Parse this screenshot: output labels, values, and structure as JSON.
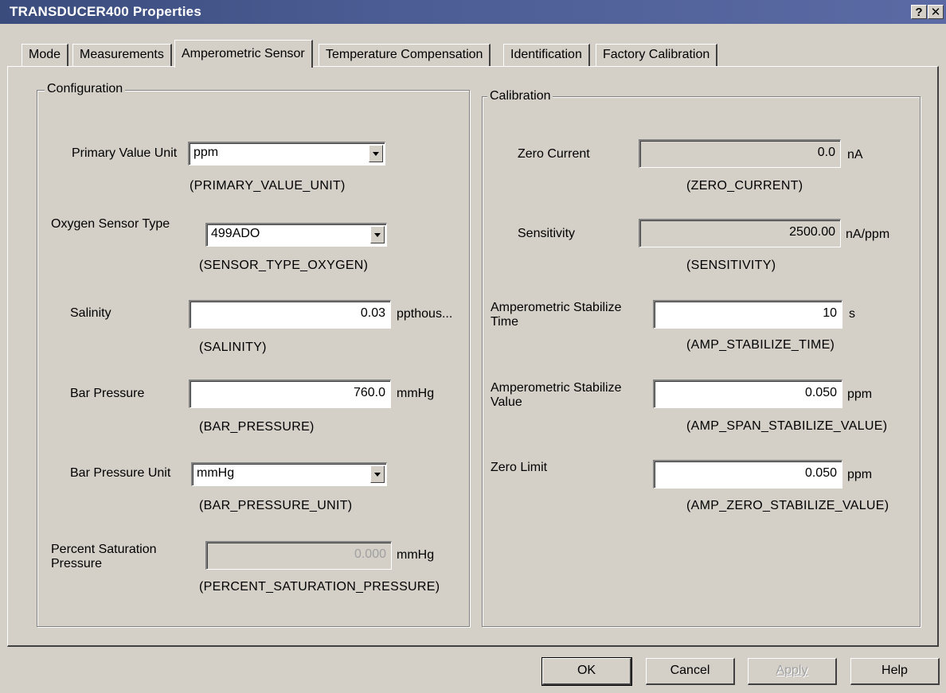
{
  "window": {
    "title": "TRANSDUCER400 Properties",
    "help_glyph": "?",
    "close_glyph": "✕"
  },
  "tabs": [
    {
      "label": "Mode"
    },
    {
      "label": "Measurements"
    },
    {
      "label": "Amperometric Sensor",
      "active": true
    },
    {
      "label": "Temperature Compensation"
    },
    {
      "label": "Identification"
    },
    {
      "label": "Factory Calibration"
    }
  ],
  "configuration": {
    "title": "Configuration",
    "primary_value_unit": {
      "label": "Primary Value Unit",
      "value": "ppm",
      "param": "(PRIMARY_VALUE_UNIT)"
    },
    "oxygen_sensor_type": {
      "label": "Oxygen Sensor Type",
      "value": "499ADO",
      "param": "(SENSOR_TYPE_OXYGEN)"
    },
    "salinity": {
      "label": "Salinity",
      "value": "0.03",
      "unit": "ppthous...",
      "param": "(SALINITY)"
    },
    "bar_pressure": {
      "label": "Bar Pressure",
      "value": "760.0",
      "unit": "mmHg",
      "param": "(BAR_PRESSURE)"
    },
    "bar_pressure_unit": {
      "label": "Bar Pressure Unit",
      "value": "mmHg",
      "param": "(BAR_PRESSURE_UNIT)"
    },
    "percent_saturation_pressure": {
      "label": "Percent Saturation Pressure",
      "value": "0.000",
      "unit": "mmHg",
      "param": "(PERCENT_SATURATION_PRESSURE)"
    }
  },
  "calibration": {
    "title": "Calibration",
    "zero_current": {
      "label": "Zero Current",
      "value": "0.0",
      "unit": "nA",
      "param": "(ZERO_CURRENT)"
    },
    "sensitivity": {
      "label": "Sensitivity",
      "value": "2500.00",
      "unit": "nA/ppm",
      "param": "(SENSITIVITY)"
    },
    "stabilize_time": {
      "label": "Amperometric Stabilize Time",
      "value": "10",
      "unit": "s",
      "param": "(AMP_STABILIZE_TIME)"
    },
    "stabilize_value": {
      "label": "Amperometric Stabilize Value",
      "value": "0.050",
      "unit": "ppm",
      "param": "(AMP_SPAN_STABILIZE_VALUE)"
    },
    "zero_limit": {
      "label": "Zero Limit",
      "value": "0.050",
      "unit": "ppm",
      "param": "(AMP_ZERO_STABILIZE_VALUE)"
    }
  },
  "buttons": {
    "ok": "OK",
    "cancel": "Cancel",
    "apply": "Apply",
    "help": "Help"
  }
}
